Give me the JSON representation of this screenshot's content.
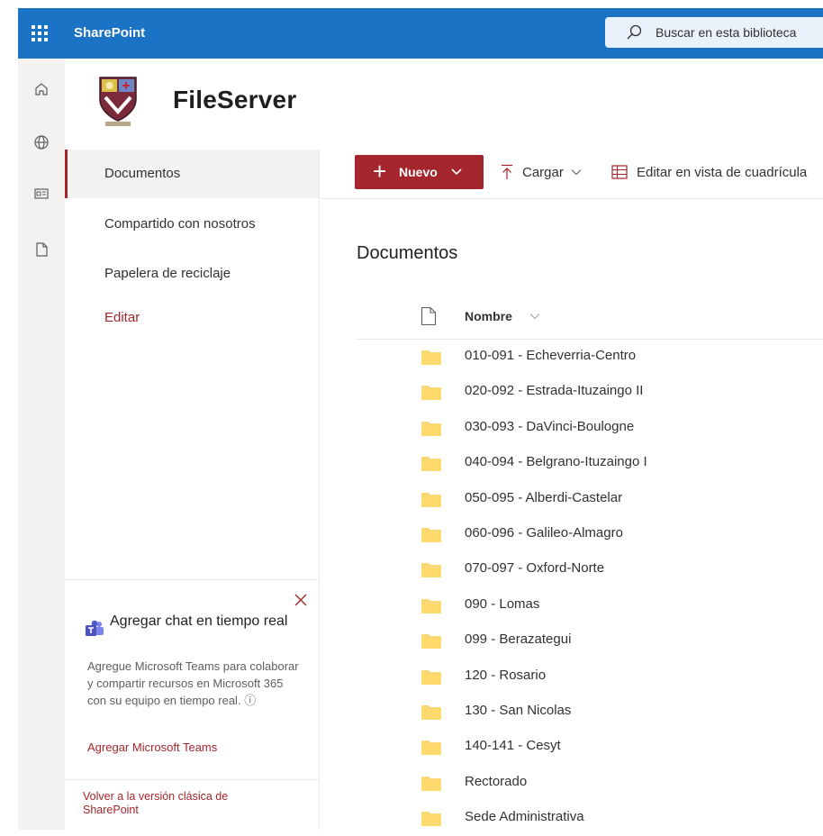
{
  "suite_bar": {
    "app_name": "SharePoint",
    "search_placeholder": "Buscar en esta biblioteca"
  },
  "rail": {
    "icons": [
      "home-icon",
      "globe-icon",
      "news-icon",
      "document-icon"
    ]
  },
  "site": {
    "title": "FileServer"
  },
  "left_nav": {
    "items": [
      {
        "label": "Documentos",
        "selected": true
      },
      {
        "label": "Compartido con nosotros",
        "selected": false
      },
      {
        "label": "Papelera de reciclaje",
        "selected": false
      }
    ],
    "edit_label": "Editar"
  },
  "teams_card": {
    "title": "Agregar chat en tiempo real",
    "description": "Agregue Microsoft Teams para colaborar y compartir recursos en Microsoft 365 con su equipo en tiempo real.",
    "link": "Agregar Microsoft Teams"
  },
  "classic_link": "Volver a la versión clásica de SharePoint",
  "command_bar": {
    "new_label": "Nuevo",
    "upload_label": "Cargar",
    "grid_label": "Editar en vista de cuadrícula"
  },
  "library": {
    "title": "Documentos",
    "column_name": "Nombre",
    "folders": [
      "010-091 - Echeverria-Centro",
      "020-092 - Estrada-Ituzaingo II",
      "030-093 - DaVinci-Boulogne",
      "040-094 - Belgrano-Ituzaingo I",
      "050-095 - Alberdi-Castelar",
      "060-096 - Galileo-Almagro",
      "070-097 - Oxford-Norte",
      "090 - Lomas",
      "099 - Berazategui",
      "120 - Rosario",
      "130 - San Nicolas",
      "140-141 - Cesyt",
      "Rectorado",
      "Sede Administrativa"
    ]
  },
  "colors": {
    "suite_bar": "#1a73c4",
    "accent": "#a4262c",
    "folder": "#f8d775"
  }
}
